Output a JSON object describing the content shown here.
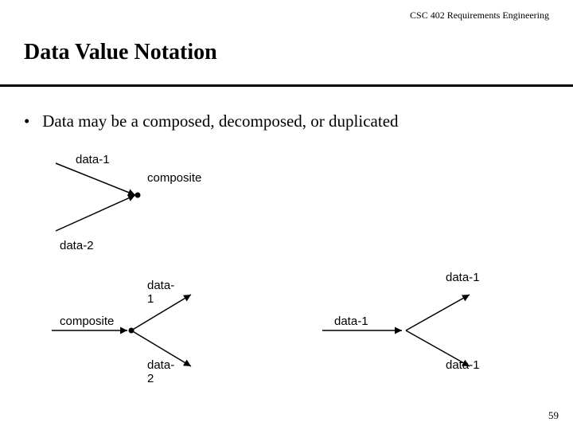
{
  "header": {
    "course": "CSC 402 Requirements Engineering"
  },
  "title": "Data Value Notation",
  "bullet": {
    "marker": "•",
    "text": "Data may be a composed, decomposed, or duplicated"
  },
  "diagram1": {
    "top_label": "data-1",
    "bottom_label": "data-2",
    "right_label": "composite"
  },
  "diagram2": {
    "left_label": "composite",
    "top_label": "data-1",
    "bottom_label": "data-2"
  },
  "diagram3": {
    "left_label": "data-1",
    "top_label": "data-1",
    "bottom_label": "data-1"
  },
  "page_number": "59"
}
